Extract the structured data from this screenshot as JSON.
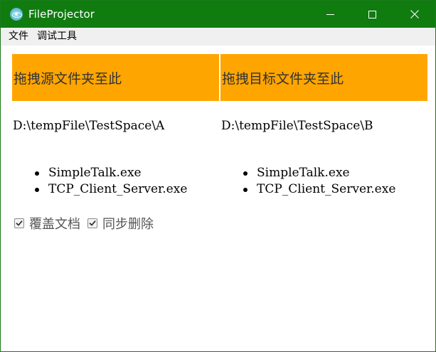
{
  "window": {
    "title": "FileProjector",
    "icon": "app-orb-icon",
    "controls": [
      "minimize-icon",
      "maximize-icon",
      "close-icon"
    ],
    "titlebar_color": "#107c10"
  },
  "menubar": {
    "items": [
      {
        "label": "文件"
      },
      {
        "label": "调试工具"
      }
    ]
  },
  "dropzones": {
    "source_label": "拖拽源文件夹至此",
    "target_label": "拖拽目标文件夹至此",
    "color": "#ffa500"
  },
  "source": {
    "path": "D:\\tempFile\\TestSpace\\A",
    "files": [
      "SimpleTalk.exe",
      "TCP_Client_Server.exe"
    ]
  },
  "target": {
    "path": "D:\\tempFile\\TestSpace\\B",
    "files": [
      "SimpleTalk.exe",
      "TCP_Client_Server.exe"
    ]
  },
  "options": {
    "overwrite": {
      "label": "覆盖文档",
      "checked": true
    },
    "sync_delete": {
      "label": "同步删除",
      "checked": true
    }
  }
}
